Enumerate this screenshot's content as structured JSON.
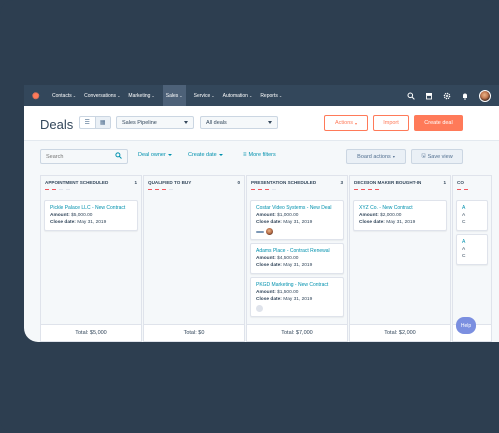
{
  "nav": {
    "items": [
      {
        "label": "Contacts"
      },
      {
        "label": "Conversations"
      },
      {
        "label": "Marketing"
      },
      {
        "label": "Sales"
      },
      {
        "label": "Service"
      },
      {
        "label": "Automation"
      },
      {
        "label": "Reports"
      }
    ],
    "active": "Sales",
    "icons": [
      "search-icon",
      "marketplace-icon",
      "settings-icon",
      "notifications-icon"
    ]
  },
  "header": {
    "title": "Deals",
    "pipeline_select": "Sales Pipeline",
    "view_select": "All deals",
    "actions_label": "Actions",
    "import_label": "Import",
    "create_label": "Create deal"
  },
  "toolbar": {
    "search_placeholder": "Search",
    "deal_owner": "Deal owner",
    "create_date": "Create date",
    "more_filters": "More filters",
    "board_actions": "Board actions",
    "save_view": "Save view"
  },
  "columns": [
    {
      "title": "APPOINTMENT SCHEDULED",
      "count": "1",
      "cards": [
        {
          "name": "Pickle Palace LLC - New Contract",
          "amount_label": "Amount:",
          "amount": "$5,000.00",
          "close_label": "Close date:",
          "close": "May 31, 2019"
        }
      ],
      "total": "Total: $5,000"
    },
    {
      "title": "QUALIFIED TO BUY",
      "count": "0",
      "cards": [],
      "total": "Total: $0"
    },
    {
      "title": "PRESENTATION SCHEDULED",
      "count": "3",
      "cards": [
        {
          "name": "Costar Video Systems - New Deal",
          "amount_label": "Amount:",
          "amount": "$1,000.00",
          "close_label": "Close date:",
          "close": "May 31, 2019"
        },
        {
          "name": "Adams Place - Contract Renewal",
          "amount_label": "Amount:",
          "amount": "$4,500.00",
          "close_label": "Close date:",
          "close": "May 31, 2019"
        },
        {
          "name": "PKGD Marketing - New Contract",
          "amount_label": "Amount:",
          "amount": "$1,500.00",
          "close_label": "Close date:",
          "close": "May 31, 2019"
        }
      ],
      "total": "Total: $7,000"
    },
    {
      "title": "DECISION MAKER BOUGHT-IN",
      "count": "1",
      "cards": [
        {
          "name": "XYZ Co. - New Contract",
          "amount_label": "Amount:",
          "amount": "$2,000.00",
          "close_label": "Close date:",
          "close": "May 31, 2019"
        }
      ],
      "total": "Total: $2,000"
    },
    {
      "title": "CO",
      "count": "",
      "cards": [
        {
          "name": "A",
          "line1": "A",
          "line2": "C"
        },
        {
          "name": "A",
          "line1": "A",
          "line2": "C"
        }
      ],
      "total": ""
    }
  ],
  "help_label": "Help",
  "colors": {
    "nav_bg": "#33475b",
    "accent": "#ff7a59",
    "link": "#0091ae",
    "frame_bg": "#2d3e50"
  }
}
